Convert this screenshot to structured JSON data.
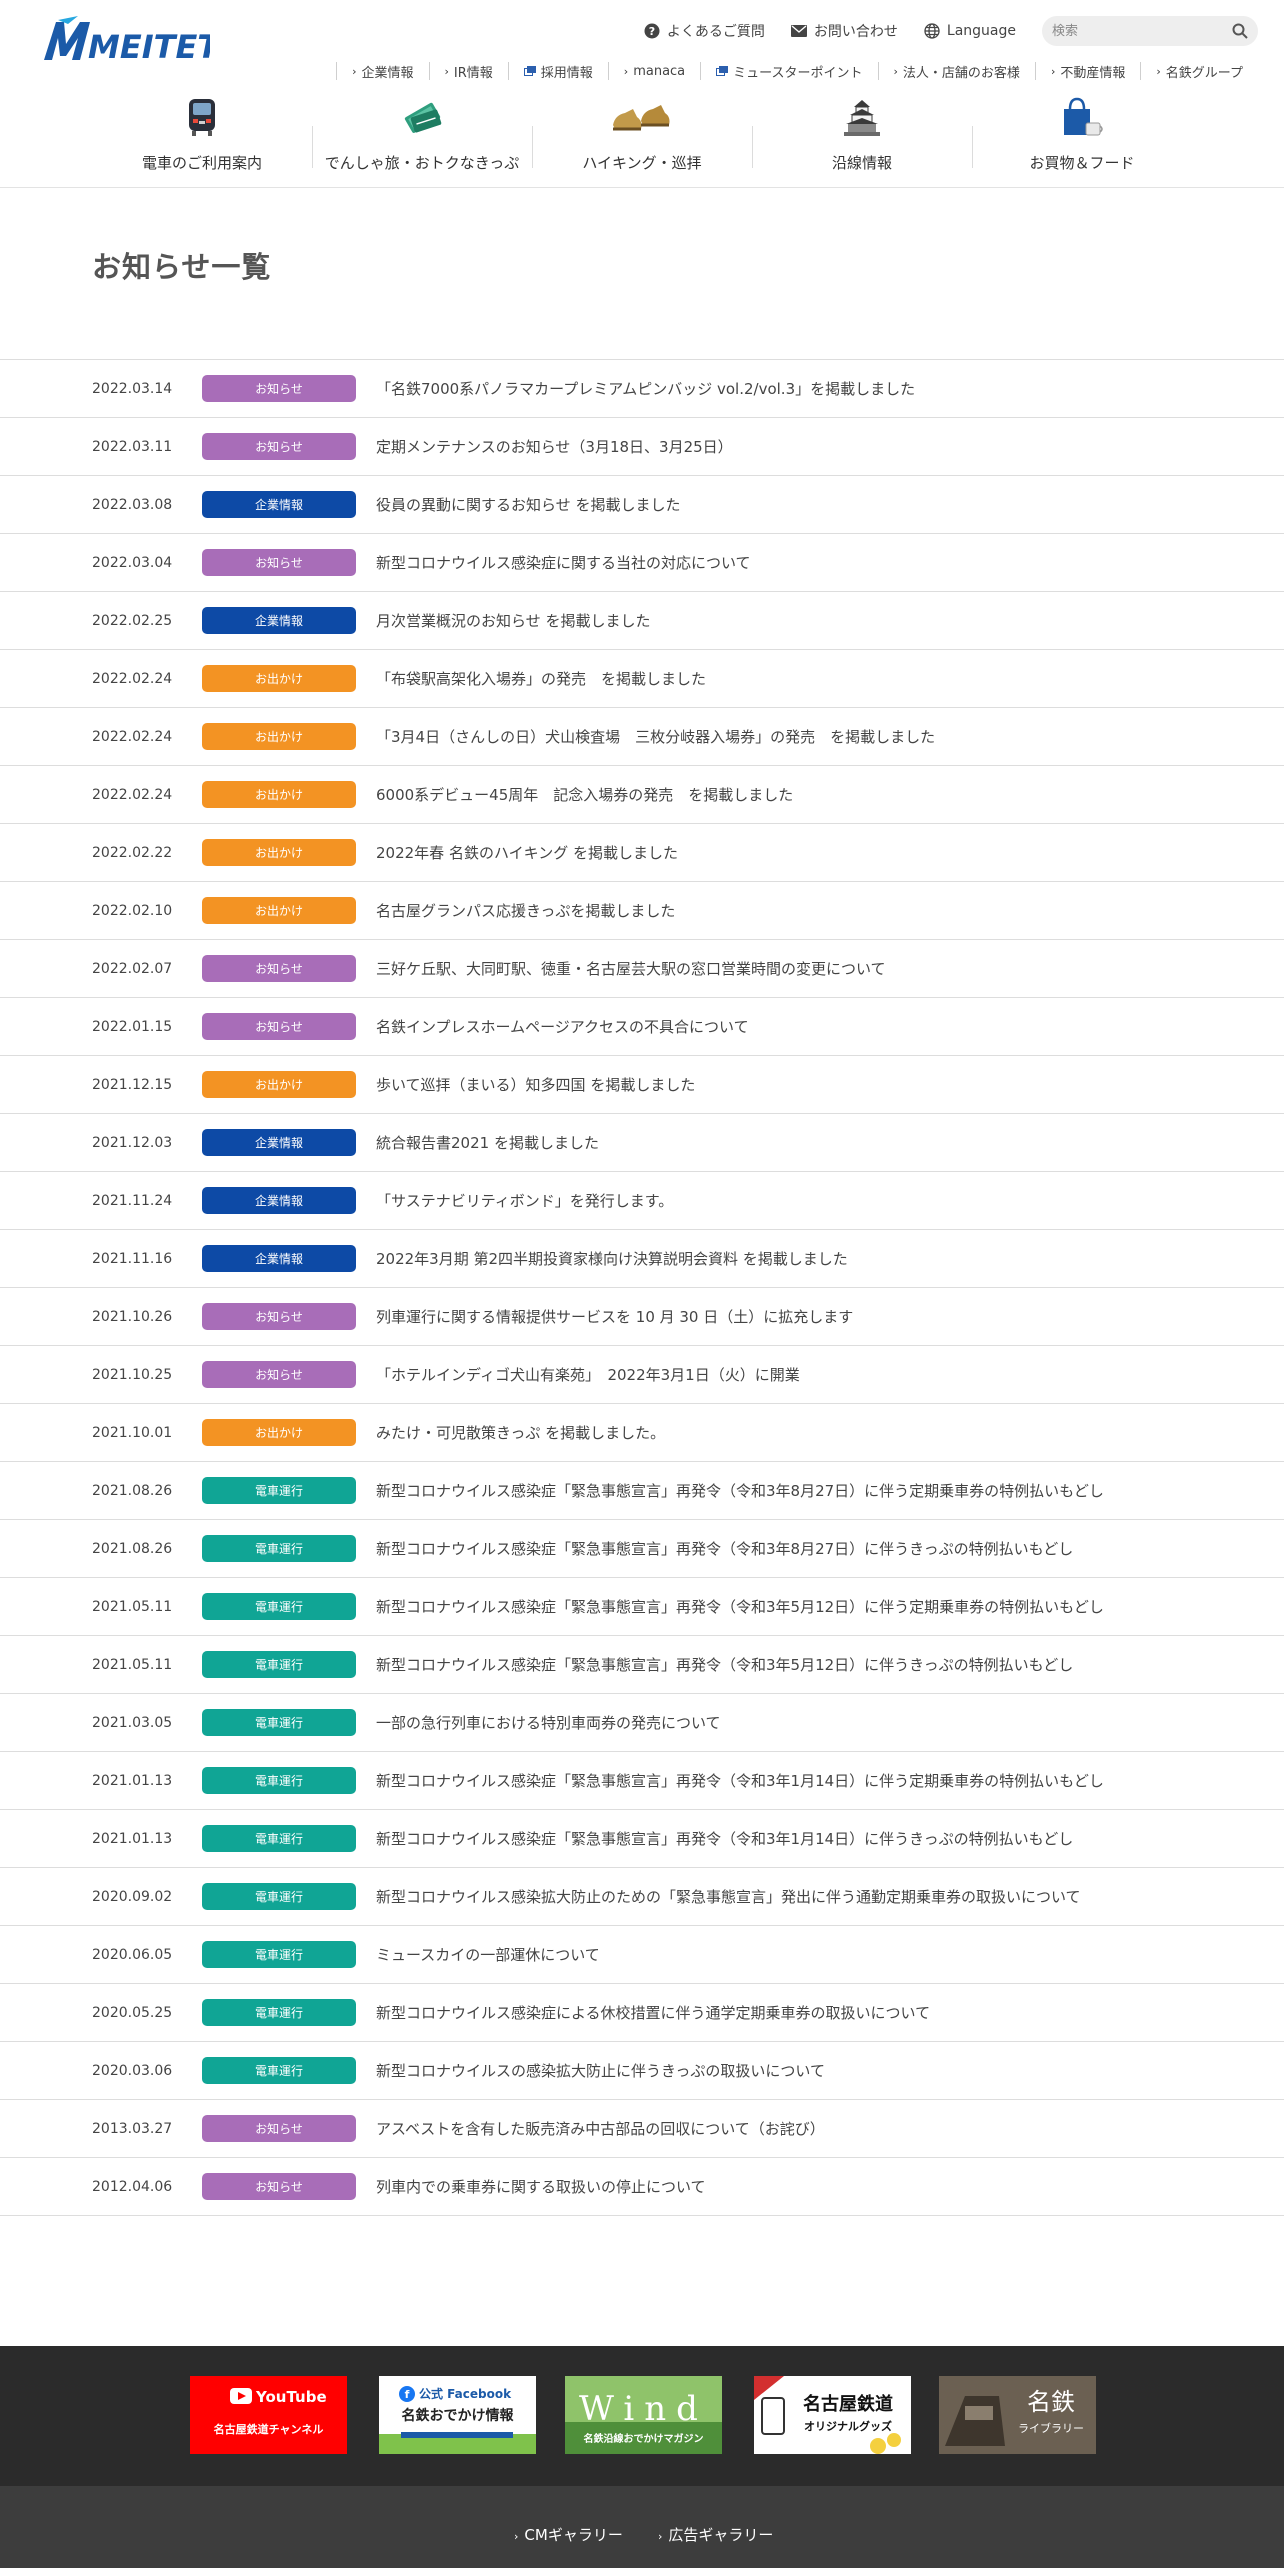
{
  "header": {
    "logo_text": "MEITETSU",
    "util_links": [
      {
        "label": "よくあるご質問",
        "icon": "question-icon"
      },
      {
        "label": "お問い合わせ",
        "icon": "mail-icon"
      },
      {
        "label": "Language",
        "icon": "globe-icon"
      }
    ],
    "search": {
      "placeholder": "検索"
    },
    "subnav": [
      {
        "label": "企業情報",
        "icon": "chevron"
      },
      {
        "label": "IR情報",
        "icon": "chevron"
      },
      {
        "label": "採用情報",
        "icon": "external"
      },
      {
        "label": "manaca",
        "icon": "chevron"
      },
      {
        "label": "ミュースターポイント",
        "icon": "external"
      },
      {
        "label": "法人・店舗のお客様",
        "icon": "chevron"
      },
      {
        "label": "不動産情報",
        "icon": "chevron"
      },
      {
        "label": "名鉄グループ",
        "icon": "chevron"
      }
    ],
    "mainnav": [
      {
        "label": "電車のご利用案内",
        "icon": "train-icon"
      },
      {
        "label": "でんしゃ旅・おトクなきっぷ",
        "icon": "ticket-icon"
      },
      {
        "label": "ハイキング・巡拝",
        "icon": "hiking-shoes-icon"
      },
      {
        "label": "沿線情報",
        "icon": "castle-icon"
      },
      {
        "label": "お買物＆フード",
        "icon": "shopping-bag-icon"
      }
    ]
  },
  "page_title": "お知らせ一覧",
  "categories": {
    "news": {
      "label": "お知らせ",
      "color": "#a86db8"
    },
    "corp": {
      "label": "企業情報",
      "color": "#0d4aa6"
    },
    "outing": {
      "label": "お出かけ",
      "color": "#f39323"
    },
    "train": {
      "label": "電車運行",
      "color": "#10a595"
    }
  },
  "news": [
    {
      "date": "2022.03.14",
      "category": "news",
      "title": "「名鉄7000系パノラマカープレミアムピンバッジ vol.2/vol.3」を掲載しました"
    },
    {
      "date": "2022.03.11",
      "category": "news",
      "title": "定期メンテナンスのお知らせ（3月18日、3月25日）"
    },
    {
      "date": "2022.03.08",
      "category": "corp",
      "title": "役員の異動に関するお知らせ を掲載しました"
    },
    {
      "date": "2022.03.04",
      "category": "news",
      "title": "新型コロナウイルス感染症に関する当社の対応について"
    },
    {
      "date": "2022.02.25",
      "category": "corp",
      "title": "月次営業概況のお知らせ を掲載しました"
    },
    {
      "date": "2022.02.24",
      "category": "outing",
      "title": "「布袋駅高架化入場券」の発売　を掲載しました"
    },
    {
      "date": "2022.02.24",
      "category": "outing",
      "title": "「3月4日（さんしの日）犬山検査場　三枚分岐器入場券」の発売　を掲載しました"
    },
    {
      "date": "2022.02.24",
      "category": "outing",
      "title": "6000系デビュー45周年　記念入場券の発売　を掲載しました"
    },
    {
      "date": "2022.02.22",
      "category": "outing",
      "title": "2022年春 名鉄のハイキング を掲載しました"
    },
    {
      "date": "2022.02.10",
      "category": "outing",
      "title": "名古屋グランパス応援きっぷを掲載しました"
    },
    {
      "date": "2022.02.07",
      "category": "news",
      "title": "三好ケ丘駅、大同町駅、徳重・名古屋芸大駅の窓口営業時間の変更について"
    },
    {
      "date": "2022.01.15",
      "category": "news",
      "title": "名鉄インプレスホームページアクセスの不具合について"
    },
    {
      "date": "2021.12.15",
      "category": "outing",
      "title": "歩いて巡拝（まいる）知多四国 を掲載しました"
    },
    {
      "date": "2021.12.03",
      "category": "corp",
      "title": "統合報告書2021 を掲載しました"
    },
    {
      "date": "2021.11.24",
      "category": "corp",
      "title": "「サステナビリティボンド」を発行します。"
    },
    {
      "date": "2021.11.16",
      "category": "corp",
      "title": "2022年3月期 第2四半期投資家様向け決算説明会資料 を掲載しました"
    },
    {
      "date": "2021.10.26",
      "category": "news",
      "title": "列車運行に関する情報提供サービスを 10 月 30 日（土）に拡充します"
    },
    {
      "date": "2021.10.25",
      "category": "news",
      "title": "「ホテルインディゴ犬山有楽苑」　2022年3月1日（火）に開業"
    },
    {
      "date": "2021.10.01",
      "category": "outing",
      "title": "みたけ・可児散策きっぷ を掲載しました。"
    },
    {
      "date": "2021.08.26",
      "category": "train",
      "title": "新型コロナウイルス感染症「緊急事態宣言」再発令（令和3年8月27日）に伴う定期乗車券の特例払いもどし"
    },
    {
      "date": "2021.08.26",
      "category": "train",
      "title": "新型コロナウイルス感染症「緊急事態宣言」再発令（令和3年8月27日）に伴うきっぷの特例払いもどし"
    },
    {
      "date": "2021.05.11",
      "category": "train",
      "title": "新型コロナウイルス感染症「緊急事態宣言」再発令（令和3年5月12日）に伴う定期乗車券の特例払いもどし"
    },
    {
      "date": "2021.05.11",
      "category": "train",
      "title": "新型コロナウイルス感染症「緊急事態宣言」再発令（令和3年5月12日）に伴うきっぷの特例払いもどし"
    },
    {
      "date": "2021.03.05",
      "category": "train",
      "title": "一部の急行列車における特別車両券の発売について"
    },
    {
      "date": "2021.01.13",
      "category": "train",
      "title": "新型コロナウイルス感染症「緊急事態宣言」再発令（令和3年1月14日）に伴う定期乗車券の特例払いもどし"
    },
    {
      "date": "2021.01.13",
      "category": "train",
      "title": "新型コロナウイルス感染症「緊急事態宣言」再発令（令和3年1月14日）に伴うきっぷの特例払いもどし"
    },
    {
      "date": "2020.09.02",
      "category": "train",
      "title": "新型コロナウイルス感染拡大防止のための「緊急事態宣言」発出に伴う通勤定期乗車券の取扱いについて"
    },
    {
      "date": "2020.06.05",
      "category": "train",
      "title": "ミュースカイの一部運休について"
    },
    {
      "date": "2020.05.25",
      "category": "train",
      "title": "新型コロナウイルス感染症による休校措置に伴う通学定期乗車券の取扱いについて"
    },
    {
      "date": "2020.03.06",
      "category": "train",
      "title": "新型コロナウイルスの感染拡大防止に伴うきっぷの取扱いについて"
    },
    {
      "date": "2013.03.27",
      "category": "news",
      "title": "アスベストを含有した販売済み中古部品の回収について（お詫び）"
    },
    {
      "date": "2012.04.06",
      "category": "news",
      "title": "列車内での乗車券に関する取扱いの停止について"
    }
  ],
  "footer": {
    "banners": [
      {
        "name": "youtube",
        "line1": "YouTube",
        "line2": "名古屋鉄道チャンネル"
      },
      {
        "name": "facebook",
        "line1": "公式 Facebook",
        "line2": "名鉄おでかけ情報"
      },
      {
        "name": "wind",
        "line1": "Wind",
        "line2": "名鉄沿線おでかけマガジン"
      },
      {
        "name": "goods",
        "line1": "名古屋鉄道",
        "line2": "オリジナルグッズ"
      },
      {
        "name": "library",
        "line1": "名鉄",
        "line2": "ライブラリー"
      }
    ],
    "links": [
      {
        "label": "CMギャラリー"
      },
      {
        "label": "広告ギャラリー"
      }
    ]
  }
}
